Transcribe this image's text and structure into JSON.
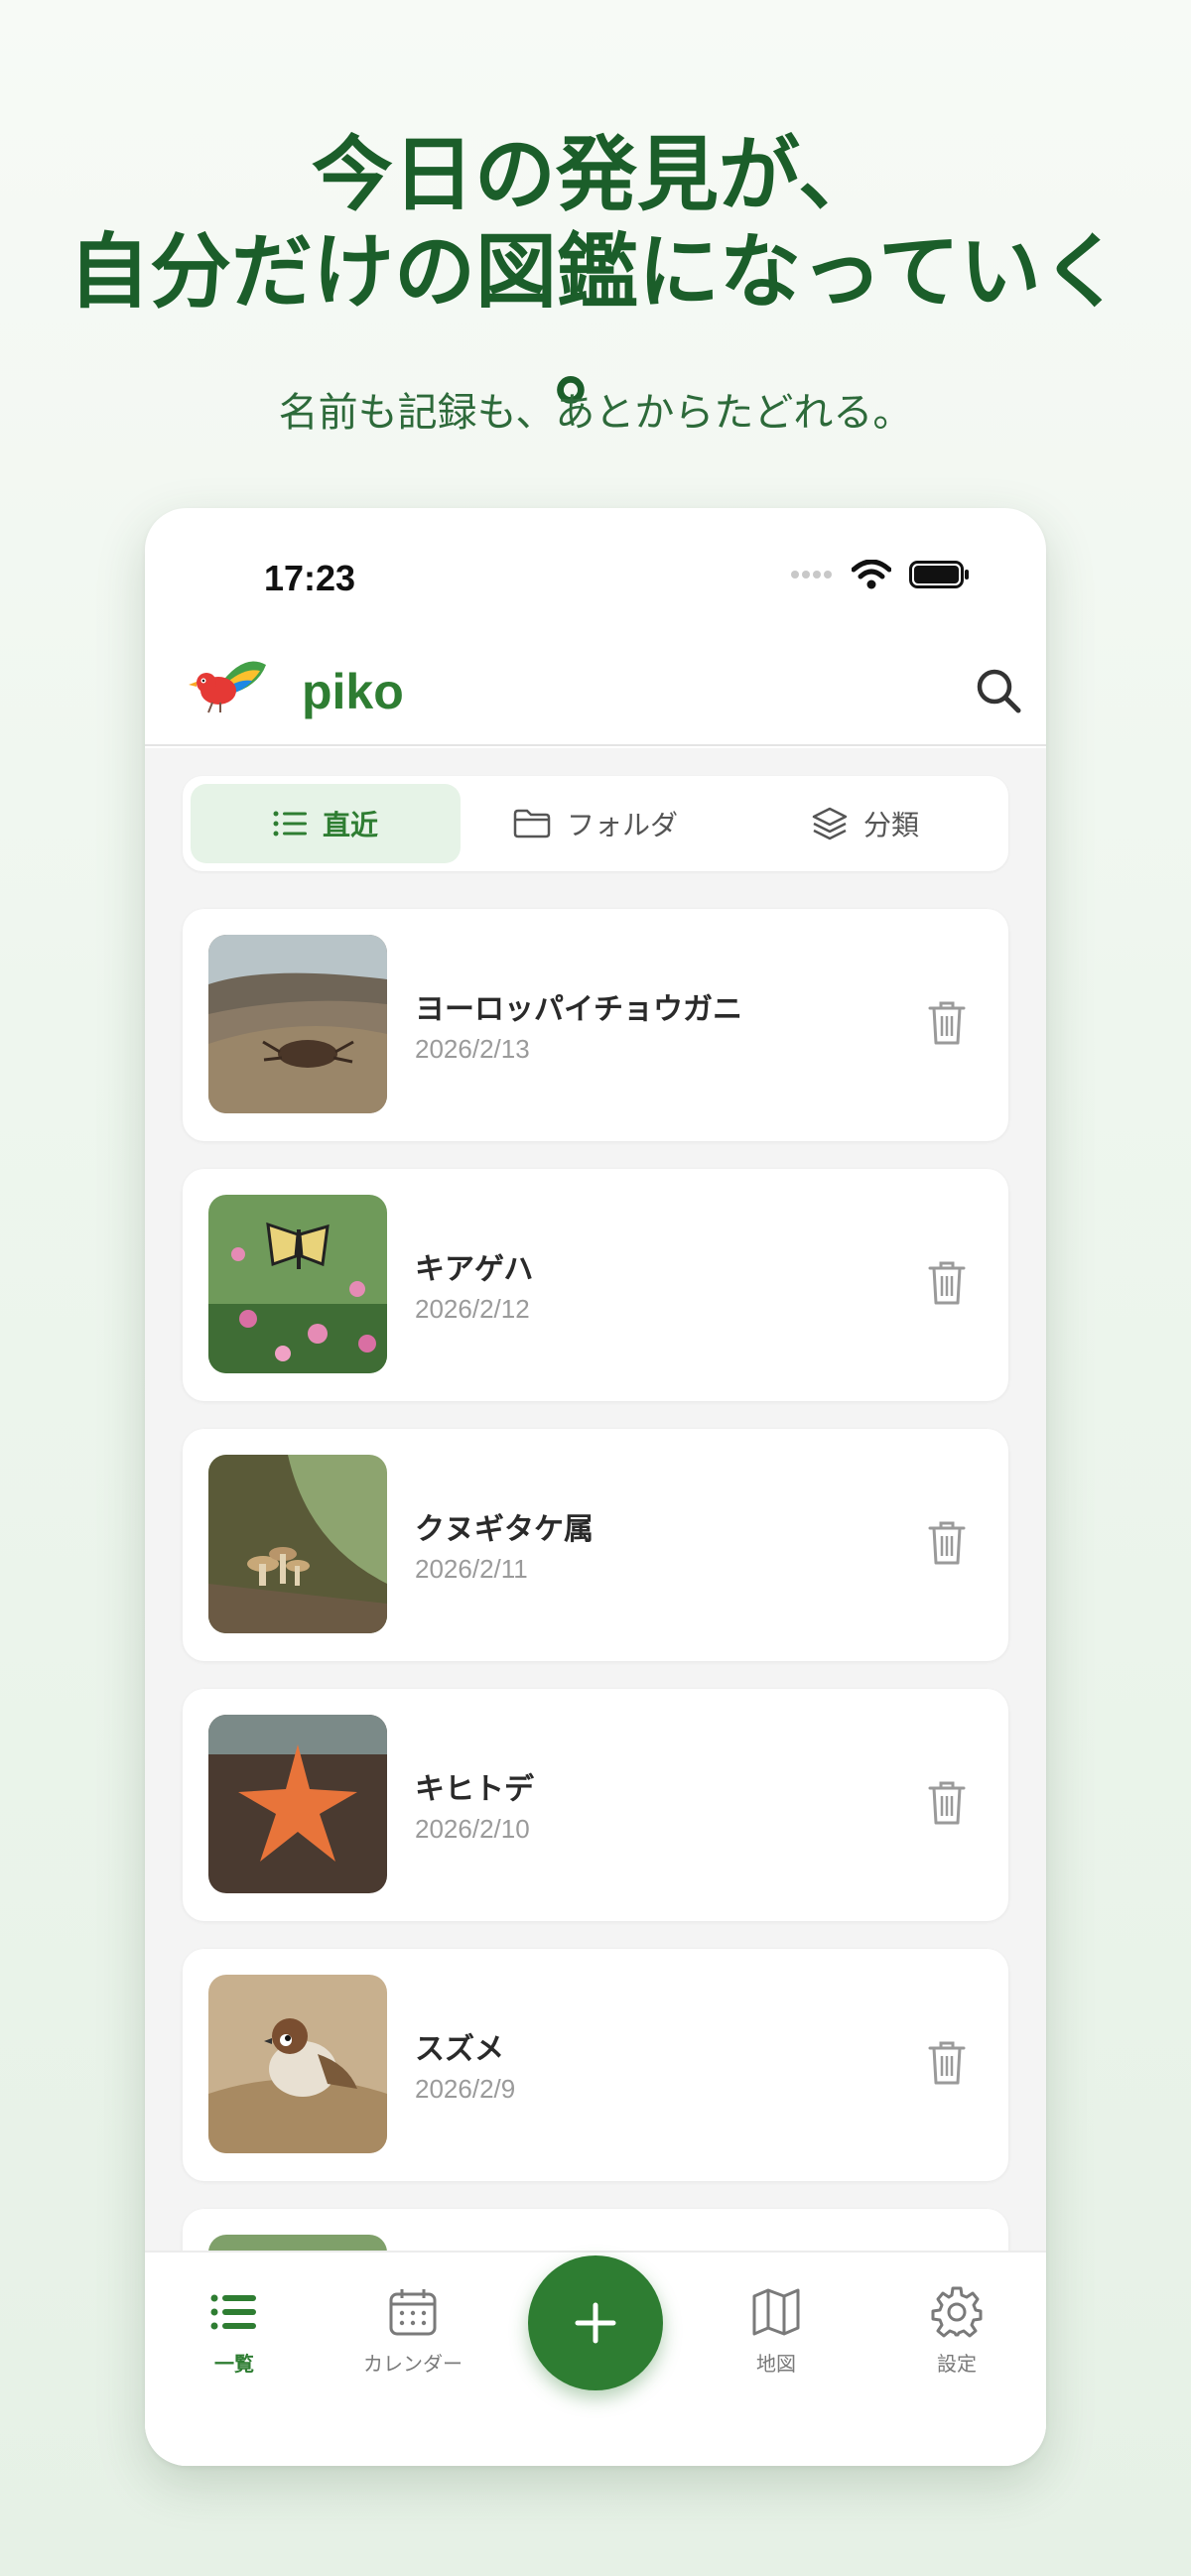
{
  "hero": {
    "headline_line1": "今日の発見が、",
    "headline_line2": "自分だけの図鑑になっていく",
    "headline_line3": "。",
    "subline": "名前も記録も、あとからたどれる。"
  },
  "status_bar": {
    "time": "17:23"
  },
  "header": {
    "app_name": "piko",
    "search_icon": "search-icon",
    "logo": "bird-logo"
  },
  "segments": [
    {
      "label": "直近",
      "icon": "list-icon",
      "active": true
    },
    {
      "label": "フォルダ",
      "icon": "folder-icon",
      "active": false
    },
    {
      "label": "分類",
      "icon": "layers-icon",
      "active": false
    }
  ],
  "entries": [
    {
      "name": "ヨーロッパイチョウガニ",
      "date": "2026/2/13",
      "thumb": "crab-photo"
    },
    {
      "name": "キアゲハ",
      "date": "2026/2/12",
      "thumb": "butterfly-photo"
    },
    {
      "name": "クヌギタケ属",
      "date": "2026/2/11",
      "thumb": "mushroom-photo"
    },
    {
      "name": "キヒトデ",
      "date": "2026/2/10",
      "thumb": "starfish-photo"
    },
    {
      "name": "スズメ",
      "date": "2026/2/9",
      "thumb": "sparrow-photo"
    }
  ],
  "tabs": [
    {
      "label": "一覧",
      "icon": "list-icon",
      "active": true
    },
    {
      "label": "カレンダー",
      "icon": "calendar-icon",
      "active": false
    },
    {
      "label": "地図",
      "icon": "map-icon",
      "active": false
    },
    {
      "label": "設定",
      "icon": "gear-icon",
      "active": false
    }
  ],
  "fab": {
    "icon": "plus-icon"
  },
  "colors": {
    "accent": "#2e7d32",
    "headline": "#1b5e2a",
    "active_segment_bg": "#e6f3e7"
  }
}
